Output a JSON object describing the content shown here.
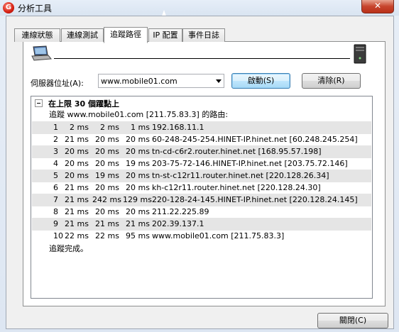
{
  "window": {
    "title": "分析工具",
    "close_glyph": "✕",
    "app_icon_glyph": "G"
  },
  "tabs": [
    {
      "label": "連線狀態"
    },
    {
      "label": "連線測試"
    },
    {
      "label": "追蹤路徑"
    },
    {
      "label": "IP 配置"
    },
    {
      "label": "事件日誌"
    }
  ],
  "active_tab": "追蹤路徑",
  "server": {
    "label": "伺服器位址(A):",
    "value": "www.mobile01.com"
  },
  "buttons": {
    "start": "啟動(S)",
    "clear": "清除(R)",
    "close": "關閉(C)"
  },
  "result": {
    "header": "在上限 30 個躍點上",
    "intro": "追蹤 www.mobile01.com [211.75.83.3] 的路由:",
    "hops": [
      {
        "n": "1",
        "t1": "2 ms",
        "t2": "2 ms",
        "t3": "1 ms",
        "host": "192.168.11.1"
      },
      {
        "n": "2",
        "t1": "21 ms",
        "t2": "20 ms",
        "t3": "20 ms",
        "host": "60-248-245-254.HINET-IP.hinet.net [60.248.245.254]"
      },
      {
        "n": "3",
        "t1": "20 ms",
        "t2": "20 ms",
        "t3": "20 ms",
        "host": "tn-cd-c6r2.router.hinet.net [168.95.57.198]"
      },
      {
        "n": "4",
        "t1": "20 ms",
        "t2": "20 ms",
        "t3": "19 ms",
        "host": "203-75-72-146.HINET-IP.hinet.net [203.75.72.146]"
      },
      {
        "n": "5",
        "t1": "20 ms",
        "t2": "19 ms",
        "t3": "20 ms",
        "host": "tn-st-c12r11.router.hinet.net [220.128.26.34]"
      },
      {
        "n": "6",
        "t1": "21 ms",
        "t2": "20 ms",
        "t3": "20 ms",
        "host": "kh-c12r11.router.hinet.net [220.128.24.30]"
      },
      {
        "n": "7",
        "t1": "21 ms",
        "t2": "242 ms",
        "t3": "129 ms",
        "host": "220-128-24-145.HINET-IP.hinet.net [220.128.24.145]"
      },
      {
        "n": "8",
        "t1": "21 ms",
        "t2": "20 ms",
        "t3": "20 ms",
        "host": "211.22.225.89"
      },
      {
        "n": "9",
        "t1": "21 ms",
        "t2": "21 ms",
        "t3": "21 ms",
        "host": "202.39.137.1"
      },
      {
        "n": "10",
        "t1": "22 ms",
        "t2": "22 ms",
        "t3": "95 ms",
        "host": "www.mobile01.com [211.75.83.3]"
      }
    ],
    "footer": "追蹤完成。"
  }
}
